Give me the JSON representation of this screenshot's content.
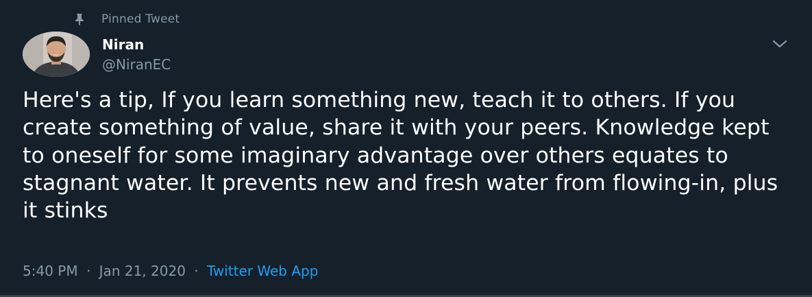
{
  "pinned": {
    "label": "Pinned Tweet",
    "icon": "pin-icon"
  },
  "author": {
    "name": "Niran",
    "handle": "@NiranEC",
    "avatar_icon": "avatar"
  },
  "menu": {
    "icon": "chevron-down-icon"
  },
  "tweet": {
    "text": "Here's a tip, If you learn something new, teach it to others. If you create something of value, share it with your peers. Knowledge kept to oneself for some imaginary advantage over others equates to stagnant water. It prevents new and fresh water from flowing-in, plus it stinks"
  },
  "meta": {
    "time": "5:40 PM",
    "separator": "·",
    "date": "Jan 21, 2020",
    "source": "Twitter Web App"
  },
  "colors": {
    "background": "#15202b",
    "primary_text": "#ffffff",
    "secondary_text": "#8899a6",
    "link": "#1da1f2"
  }
}
